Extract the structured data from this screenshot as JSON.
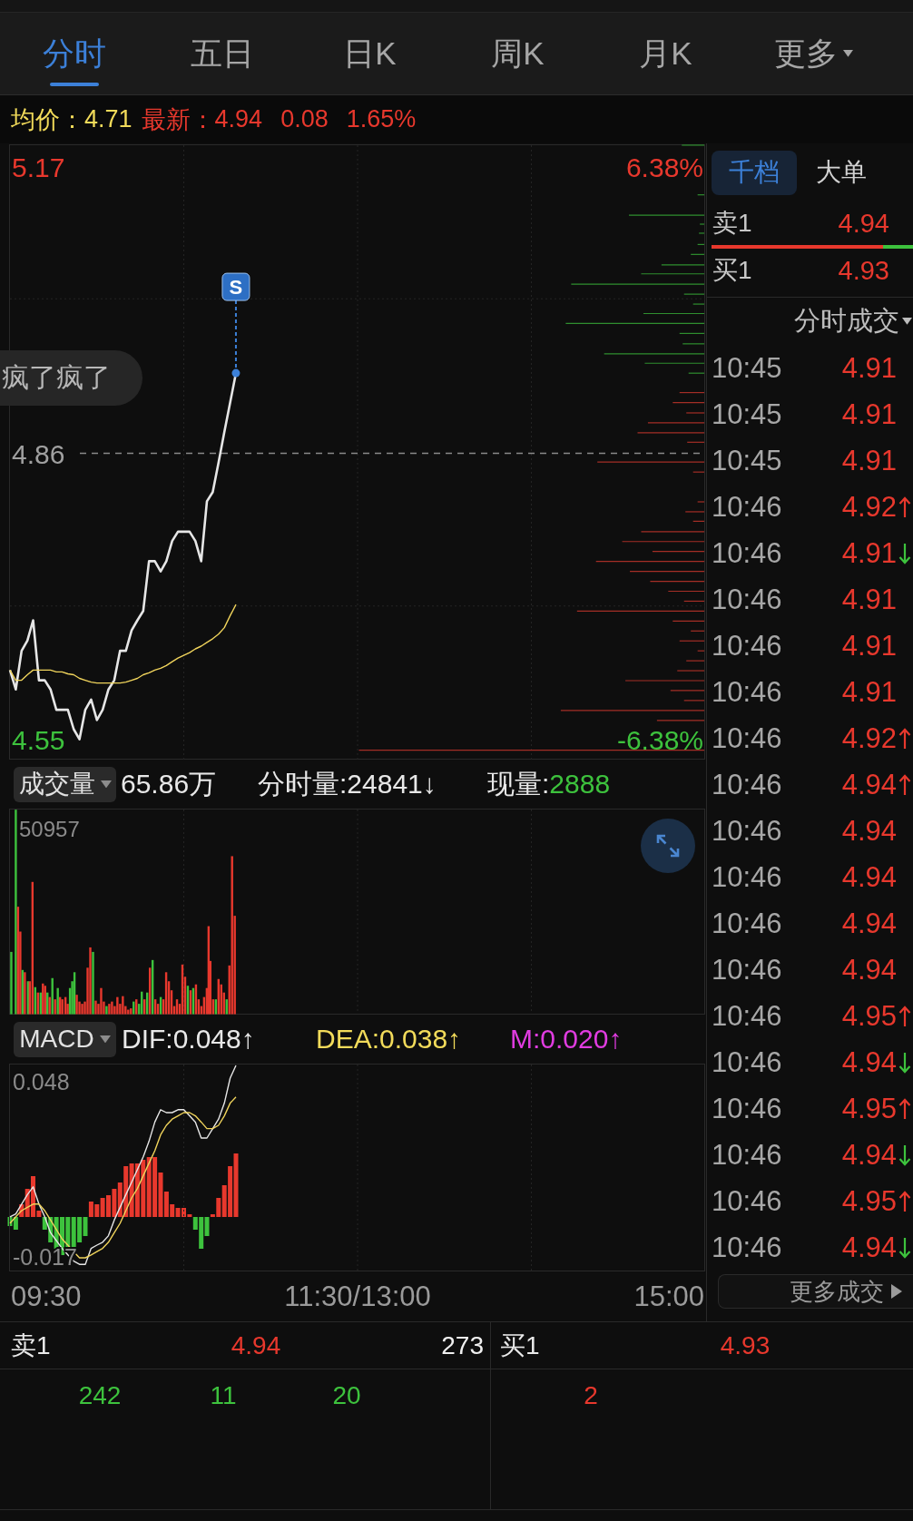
{
  "tabs": [
    {
      "label": "分时",
      "selected": true,
      "dropdown": false
    },
    {
      "label": "五日",
      "selected": false,
      "dropdown": false
    },
    {
      "label": "日K",
      "selected": false,
      "dropdown": false
    },
    {
      "label": "周K",
      "selected": false,
      "dropdown": false
    },
    {
      "label": "月K",
      "selected": false,
      "dropdown": false
    },
    {
      "label": "更多",
      "selected": false,
      "dropdown": true
    }
  ],
  "quote_bar": {
    "average_label": "均价：",
    "average": "4.71",
    "latest_label": "最新：",
    "latest": "4.94",
    "change": "0.08",
    "change_percent": "1.65%"
  },
  "price_chart": {
    "chart_data": {
      "type": "line",
      "categories": [
        null,
        null,
        null,
        null,
        null,
        null,
        null,
        null,
        null,
        null,
        null,
        null,
        null,
        null,
        null,
        null,
        null,
        null,
        null,
        null,
        null,
        null,
        null,
        null,
        null,
        null,
        null,
        null,
        null,
        null,
        null,
        null,
        null,
        null,
        null,
        null,
        null,
        null,
        null,
        null,
        null,
        null,
        null,
        null,
        null,
        null,
        null,
        null,
        null,
        null,
        null,
        null,
        null,
        null,
        null,
        null,
        null,
        null,
        null,
        null,
        null,
        null,
        null,
        null,
        null,
        null,
        null,
        null,
        null,
        null,
        null,
        null,
        null,
        null,
        null,
        null,
        null,
        null,
        null,
        null,
        null,
        null,
        null,
        null,
        null,
        null,
        null,
        null,
        null,
        null,
        null,
        null,
        null,
        null,
        null,
        null,
        null,
        null,
        null,
        null,
        null,
        null,
        null,
        null,
        null,
        null,
        null,
        null,
        null,
        null,
        null,
        null,
        null,
        null,
        null,
        null,
        null,
        null,
        null,
        null,
        null
      ],
      "series": [
        {
          "color": "#e6e6e6",
          "values": [
            4.625,
            4.604,
            4.646,
            4.657,
            4.679,
            4.614,
            4.614,
            4.604,
            4.582,
            4.582,
            4.582,
            4.561,
            4.55,
            4.582,
            4.593,
            4.571,
            4.582,
            4.604,
            4.614,
            4.646,
            4.646,
            4.668,
            4.679,
            4.689,
            4.743,
            4.743,
            4.732,
            4.743,
            4.765,
            4.775,
            4.775,
            4.775,
            4.765,
            4.743,
            4.808,
            4.818,
            4.85,
            4.883,
            4.915,
            4.947,
            null,
            null,
            null,
            null,
            null,
            null,
            null,
            null,
            null,
            null,
            null,
            null,
            null,
            null,
            null,
            null,
            null,
            null,
            null,
            null,
            null,
            null,
            null,
            null,
            null,
            null,
            null,
            null,
            null,
            null,
            null,
            null,
            null,
            null,
            null,
            null,
            null,
            null,
            null,
            null,
            null,
            null,
            null,
            null,
            null,
            null,
            null,
            null,
            null,
            null,
            null,
            null,
            null,
            null,
            null,
            null,
            null,
            null,
            null,
            null,
            null,
            null,
            null,
            null,
            null,
            null,
            null,
            null,
            null,
            null,
            null,
            null,
            null,
            null,
            null,
            null,
            null,
            null,
            null,
            null,
            null
          ]
        },
        {
          "color": "#f0d45c",
          "values": [
            4.625,
            4.614,
            4.614,
            4.62,
            4.625,
            4.625,
            4.625,
            4.625,
            4.623,
            4.623,
            4.621,
            4.62,
            4.616,
            4.614,
            4.612,
            4.611,
            4.611,
            4.611,
            4.611,
            4.611,
            4.612,
            4.614,
            4.616,
            4.62,
            4.622,
            4.625,
            4.627,
            4.63,
            4.634,
            4.638,
            4.641,
            4.644,
            4.648,
            4.651,
            4.655,
            4.659,
            4.664,
            4.671,
            4.684,
            4.696,
            null,
            null,
            null,
            null,
            null,
            null,
            null,
            null,
            null,
            null,
            null,
            null,
            null,
            null,
            null,
            null,
            null,
            null,
            null,
            null,
            null,
            null,
            null,
            null,
            null,
            null,
            null,
            null,
            null,
            null,
            null,
            null,
            null,
            null,
            null,
            null,
            null,
            null,
            null,
            null,
            null,
            null,
            null,
            null,
            null,
            null,
            null,
            null,
            null,
            null,
            null,
            null,
            null,
            null,
            null,
            null,
            null,
            null,
            null,
            null,
            null,
            null,
            null,
            null,
            null,
            null,
            null,
            null,
            null,
            null,
            null,
            null,
            null,
            null,
            null,
            null,
            null,
            null,
            null,
            null,
            null
          ]
        }
      ],
      "ylim": [
        4.528,
        5.194
      ],
      "yticks": [
        4.55,
        4.86,
        5.17
      ],
      "ref_lines": [
        {
          "axis": "y",
          "value": 4.86
        }
      ]
    },
    "percent_labels": [
      "6.38%",
      "-6.38%"
    ],
    "signal_marker": "S",
    "comment": "疯了疯了"
  },
  "volume_panel": {
    "indicator": "成交量",
    "total": "65.86万",
    "minute_volume": "分时量:24841↓",
    "current_label": "现量:",
    "current": "2888",
    "max_label": "50957"
  },
  "macd_panel": {
    "indicator": "MACD",
    "dif": "DIF:0.048↑",
    "dea": "DEA:0.038↑",
    "m": "M:0.020↑",
    "chart_data": {
      "type": "line",
      "categories": [
        null,
        null,
        null,
        null,
        null,
        null,
        null,
        null,
        null,
        null,
        null,
        null,
        null,
        null,
        null,
        null,
        null,
        null,
        null,
        null,
        null,
        null,
        null,
        null,
        null,
        null,
        null,
        null,
        null,
        null,
        null,
        null,
        null,
        null,
        null,
        null,
        null,
        null,
        null,
        null,
        null,
        null,
        null,
        null,
        null,
        null,
        null,
        null,
        null,
        null,
        null,
        null,
        null,
        null,
        null,
        null,
        null,
        null,
        null,
        null,
        null,
        null,
        null,
        null,
        null,
        null,
        null,
        null,
        null,
        null,
        null,
        null,
        null,
        null,
        null,
        null,
        null,
        null,
        null,
        null,
        null,
        null,
        null,
        null,
        null,
        null,
        null,
        null,
        null,
        null,
        null,
        null,
        null,
        null,
        null,
        null,
        null,
        null,
        null,
        null,
        null,
        null,
        null,
        null,
        null,
        null,
        null,
        null,
        null,
        null,
        null,
        null,
        null,
        null,
        null,
        null,
        null,
        null,
        null,
        null,
        null
      ],
      "series": [
        {
          "color": "#e6e6e6",
          "values": [
            -0.0021,
            -0.001,
            0.0026,
            0.0061,
            0.009,
            0.0026,
            -0.0021,
            -0.008,
            -0.0109,
            -0.0138,
            -0.0162,
            -0.0185,
            -0.0197,
            -0.0197,
            -0.0138,
            -0.0126,
            -0.0115,
            -0.0091,
            -0.0033,
            0.0014,
            0.0061,
            0.0107,
            0.0154,
            0.0201,
            0.0259,
            0.033,
            0.0376,
            0.0365,
            0.0365,
            0.0376,
            0.0376,
            0.0353,
            0.033,
            0.0271,
            0.0271,
            0.0306,
            0.0341,
            0.04,
            0.0493,
            0.054,
            null,
            null,
            null,
            null,
            null,
            null,
            null,
            null,
            null,
            null,
            null,
            null,
            null,
            null,
            null,
            null,
            null,
            null,
            null,
            null,
            null,
            null,
            null,
            null,
            null,
            null,
            null,
            null,
            null,
            null,
            null,
            null,
            null,
            null,
            null,
            null,
            null,
            null,
            null,
            null,
            null,
            null,
            null,
            null,
            null,
            null,
            null,
            null,
            null,
            null,
            null,
            null,
            null,
            null,
            null,
            null,
            null,
            null,
            null,
            null,
            null,
            null,
            null,
            null,
            null,
            null,
            null,
            null,
            null,
            null,
            null,
            null,
            null,
            null,
            null,
            null,
            null,
            null,
            null,
            null,
            null
          ]
        },
        {
          "color": "#f0d45c",
          "values": [
            -0.0045,
            -0.0021,
            0.0002,
            0.0014,
            0.0026,
            0.0026,
            0.0002,
            -0.0033,
            -0.0068,
            -0.0103,
            -0.0126,
            -0.015,
            -0.0173,
            -0.0173,
            -0.0162,
            -0.015,
            -0.0138,
            -0.0115,
            -0.008,
            -0.0045,
            0.0002,
            0.0049,
            0.0084,
            0.0131,
            0.0178,
            0.0224,
            0.0283,
            0.0318,
            0.0341,
            0.0353,
            0.0365,
            0.0365,
            0.0353,
            0.033,
            0.0306,
            0.0306,
            0.0318,
            0.0353,
            0.04,
            0.0423,
            null,
            null,
            null,
            null,
            null,
            null,
            null,
            null,
            null,
            null,
            null,
            null,
            null,
            null,
            null,
            null,
            null,
            null,
            null,
            null,
            null,
            null,
            null,
            null,
            null,
            null,
            null,
            null,
            null,
            null,
            null,
            null,
            null,
            null,
            null,
            null,
            null,
            null,
            null,
            null,
            null,
            null,
            null,
            null,
            null,
            null,
            null,
            null,
            null,
            null,
            null,
            null,
            null,
            null,
            null,
            null,
            null,
            null,
            null,
            null,
            null,
            null,
            null,
            null,
            null,
            null,
            null,
            null,
            null,
            null,
            null,
            null,
            null,
            null,
            null,
            null,
            null,
            null,
            null,
            null,
            null
          ]
        }
      ],
      "ylim": [
        -0.022,
        0.054
      ],
      "yticks": [
        -0.017,
        0.048
      ]
    }
  },
  "time_axis": [
    "09:30",
    "11:30/13:00",
    "15:00"
  ],
  "side_panel": {
    "tabs": [
      {
        "label": "千档",
        "selected": true
      },
      {
        "label": "大单",
        "selected": false
      }
    ],
    "ask": {
      "label": "卖1",
      "price": "4.94"
    },
    "ratio_bar": {
      "level": 0.85
    },
    "bid": {
      "label": "买1",
      "price": "4.93"
    },
    "trades_header": "分时成交",
    "trades": [
      {
        "time": "10:45",
        "price": "4.91",
        "up": false,
        "down": false
      },
      {
        "time": "10:45",
        "price": "4.91",
        "up": false,
        "down": false
      },
      {
        "time": "10:45",
        "price": "4.91",
        "up": false,
        "down": false
      },
      {
        "time": "10:46",
        "price": "4.92",
        "up": true,
        "down": false
      },
      {
        "time": "10:46",
        "price": "4.91",
        "up": false,
        "down": true
      },
      {
        "time": "10:46",
        "price": "4.91",
        "up": false,
        "down": false
      },
      {
        "time": "10:46",
        "price": "4.91",
        "up": false,
        "down": false
      },
      {
        "time": "10:46",
        "price": "4.91",
        "up": false,
        "down": false
      },
      {
        "time": "10:46",
        "price": "4.92",
        "up": true,
        "down": false
      },
      {
        "time": "10:46",
        "price": "4.94",
        "up": true,
        "down": false
      },
      {
        "time": "10:46",
        "price": "4.94",
        "up": false,
        "down": false
      },
      {
        "time": "10:46",
        "price": "4.94",
        "up": false,
        "down": false
      },
      {
        "time": "10:46",
        "price": "4.94",
        "up": false,
        "down": false
      },
      {
        "time": "10:46",
        "price": "4.94",
        "up": false,
        "down": false
      },
      {
        "time": "10:46",
        "price": "4.95",
        "up": true,
        "down": false
      },
      {
        "time": "10:46",
        "price": "4.94",
        "up": false,
        "down": true
      },
      {
        "time": "10:46",
        "price": "4.95",
        "up": true,
        "down": false
      },
      {
        "time": "10:46",
        "price": "4.94",
        "up": false,
        "down": true
      },
      {
        "time": "10:46",
        "price": "4.95",
        "up": true,
        "down": false
      },
      {
        "time": "10:46",
        "price": "4.94",
        "up": false,
        "down": true
      }
    ],
    "more_button": "更多成交"
  },
  "order_book": [
    {
      "kind": "sell",
      "label": "卖1",
      "price": "4.94",
      "volume": "273",
      "orders": [
        "242",
        "11",
        "20"
      ]
    },
    {
      "kind": "buy",
      "label": "买1",
      "price": "4.93",
      "orders": [
        "2"
      ]
    }
  ]
}
